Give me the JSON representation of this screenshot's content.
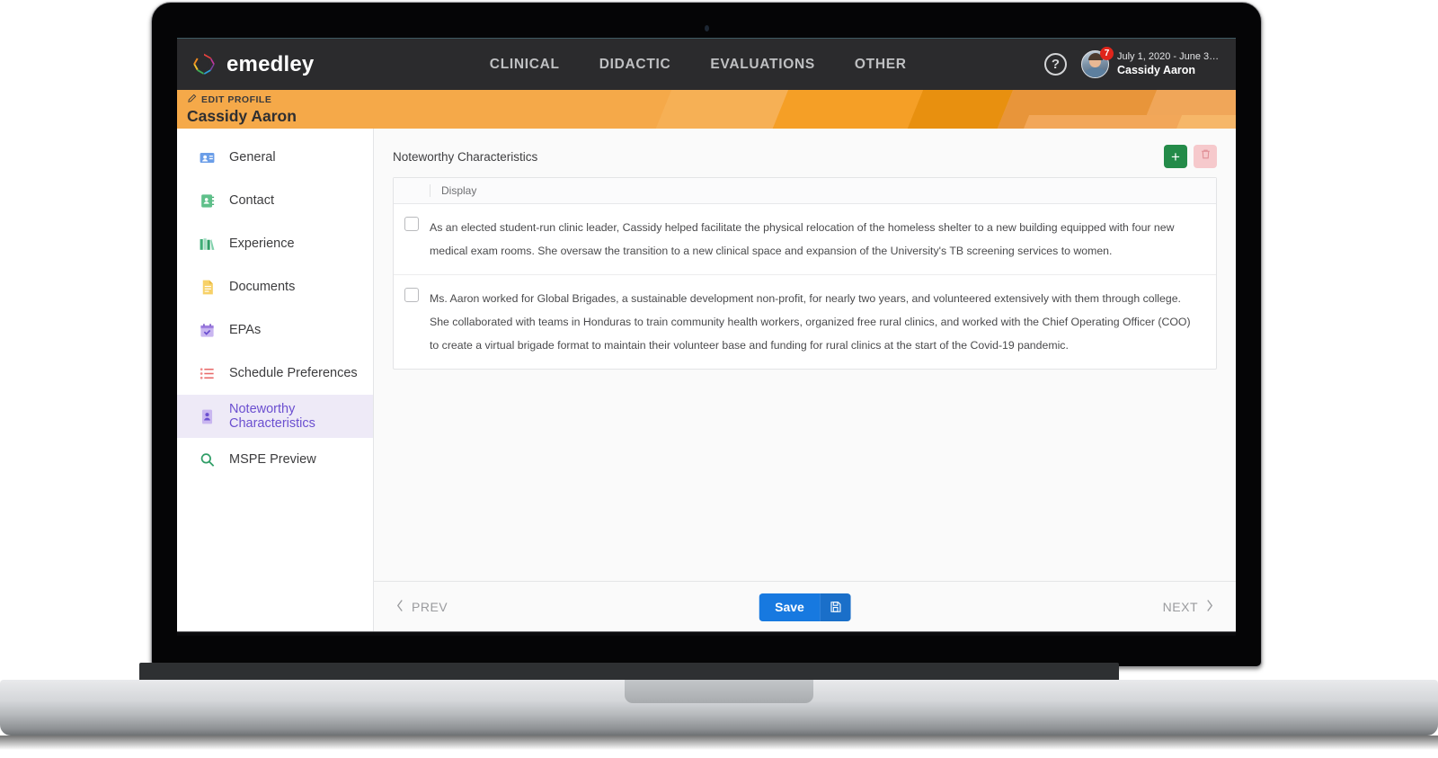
{
  "topbar": {
    "brand_name": "emedley",
    "logo_icon": "emedley-hexagon-logo",
    "nav": [
      {
        "label": "CLINICAL"
      },
      {
        "label": "DIDACTIC"
      },
      {
        "label": "EVALUATIONS"
      },
      {
        "label": "OTHER"
      }
    ],
    "help_icon": "question-mark-circle-icon",
    "help_glyph": "?",
    "user": {
      "term": "July 1, 2020 - June 30, …",
      "name": "Cassidy Aaron",
      "notification_count": "7",
      "avatar_icon": "user-avatar"
    }
  },
  "banner": {
    "edit_profile_label": "EDIT PROFILE",
    "edit_icon": "pencil-icon",
    "profile_name": "Cassidy Aaron",
    "base_color": "#f5a949"
  },
  "sidebar": {
    "items": [
      {
        "label": "General",
        "icon": "id-card-icon",
        "active": false
      },
      {
        "label": "Contact",
        "icon": "address-book-icon",
        "active": false
      },
      {
        "label": "Experience",
        "icon": "books-icon",
        "active": false
      },
      {
        "label": "Documents",
        "icon": "document-icon",
        "active": false
      },
      {
        "label": "EPAs",
        "icon": "calendar-check-icon",
        "active": false
      },
      {
        "label": "Schedule Preferences",
        "icon": "list-icon",
        "active": false
      },
      {
        "label": "Noteworthy Characteristics",
        "icon": "profile-card-icon",
        "active": true
      },
      {
        "label": "MSPE Preview",
        "icon": "magnifier-icon",
        "active": false
      }
    ],
    "active_color": "#6b4fd0",
    "active_background": "#eeeaf7"
  },
  "main": {
    "panel_title": "Noteworthy Characteristics",
    "add_button": {
      "label": "+",
      "icon": "plus-icon",
      "color": "#248b49"
    },
    "delete_button": {
      "icon": "trash-icon",
      "color": "#f6c9cc"
    },
    "table": {
      "columns": [
        "",
        "Display"
      ],
      "rows": [
        {
          "checked": false,
          "display": "As an elected student-run clinic leader, Cassidy helped facilitate the physical relocation of the homeless shelter to a new building equipped with four new medical exam rooms. She oversaw the transition to a new clinical space and expansion of the University's TB screening services to women."
        },
        {
          "checked": false,
          "display": "Ms. Aaron worked for Global Brigades, a sustainable development non-profit, for nearly two years, and volunteered extensively with them through college. She collaborated with teams in Honduras to train community health workers, organized free rural clinics, and worked with the Chief Operating Officer (COO) to create a virtual brigade format to maintain their volunteer base and funding for rural clinics at the start of the Covid-19 pandemic."
        }
      ]
    }
  },
  "footer": {
    "prev_label": "PREV",
    "next_label": "NEXT",
    "save_label": "Save",
    "save_icon": "floppy-disk-icon",
    "save_color": "#1779e0"
  }
}
